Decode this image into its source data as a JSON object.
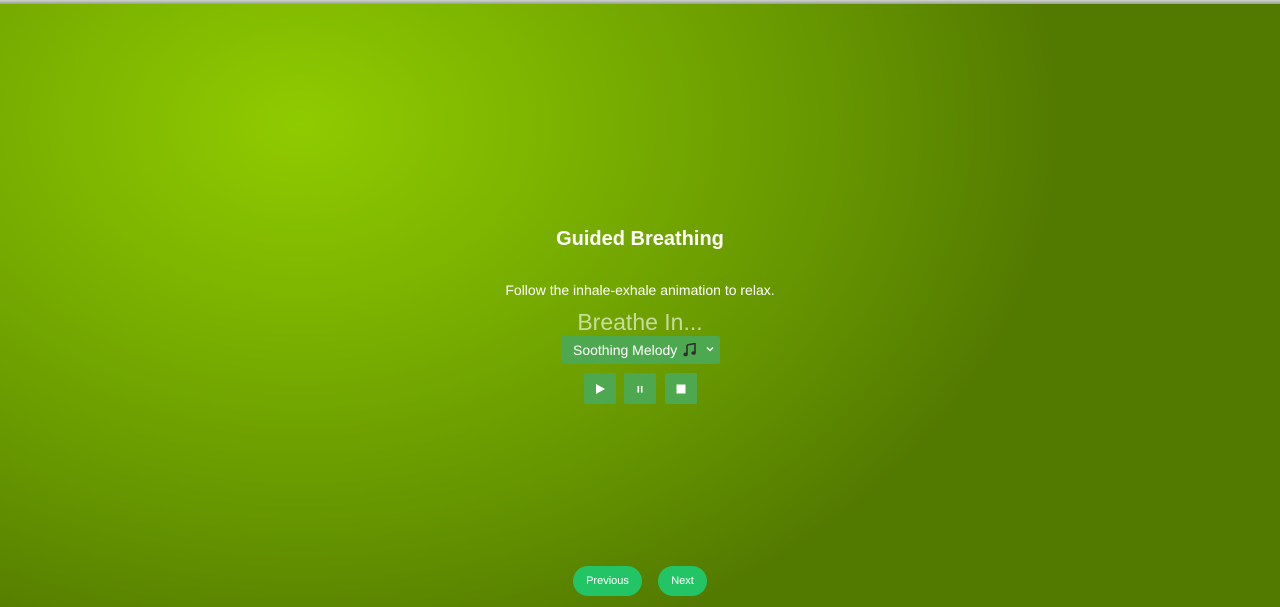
{
  "page": {
    "title": "Guided Breathing",
    "subtitle": "Follow the inhale-exhale animation to relax.",
    "breathing_status": "Breathe In..."
  },
  "sound_select": {
    "selected_label": "Soothing Melody",
    "icon": "music-note-icon"
  },
  "controls": {
    "play_icon": "play-icon",
    "pause_icon": "pause-icon",
    "stop_icon": "stop-icon"
  },
  "navigation": {
    "previous_label": "Previous",
    "next_label": "Next"
  },
  "colors": {
    "background_light": "#8fcb00",
    "background_dark": "#537a00",
    "control_bg": "#4ea84f",
    "nav_button_bg": "#22c466",
    "text": "#ffffff"
  }
}
